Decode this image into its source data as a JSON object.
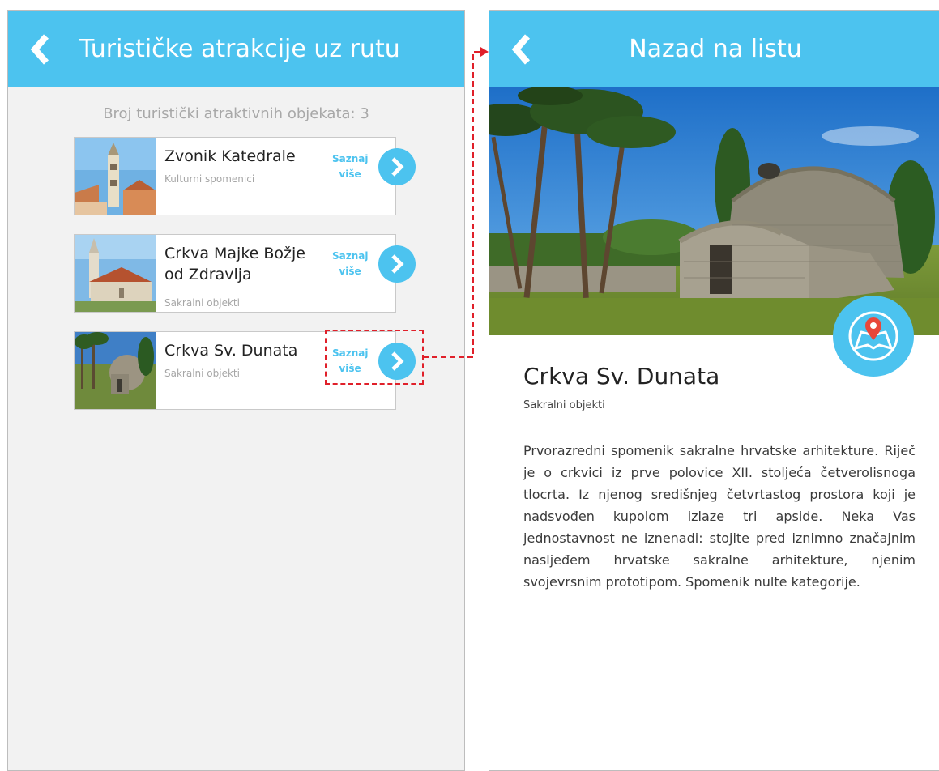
{
  "list_screen": {
    "title": "Turističke atrakcije uz rutu",
    "count_text": "Broj turistički atraktivnih objekata: 3",
    "items": [
      {
        "title": "Zvonik Katedrale",
        "category": "Kulturni spomenici",
        "more_label": "Saznaj više"
      },
      {
        "title": "Crkva Majke Božje od Zdravlja",
        "category": "Sakralni objekti",
        "more_label": "Saznaj više"
      },
      {
        "title": "Crkva Sv. Dunata",
        "category": "Sakralni objekti",
        "more_label": "Saznaj više"
      }
    ]
  },
  "detail_screen": {
    "header_title": "Nazad na listu",
    "title": "Crkva Sv. Dunata",
    "category": "Sakralni objekti",
    "description": "Prvorazredni spomenik sakralne hrvatske arhitekture. Riječ je o crkvici iz prve polovice XII. stoljeća četverolisnoga tlocrta. Iz njenog središnjeg četvrtastog prostora koji je nadsvođen kupolom izlaze tri apside. Neka Vas jednostavnost ne iznenadi: stojite pred iznimno značajnim nasljeđem hrvatske sakralne arhitekture, njenim svojevrsnim prototipom. Spomenik nulte kategorije."
  },
  "colors": {
    "accent": "#4cc3ef",
    "annotation": "#e0202a"
  },
  "icons": {
    "back": "chevron-left-icon",
    "more": "chevron-right-icon",
    "map": "map-pin-icon"
  }
}
